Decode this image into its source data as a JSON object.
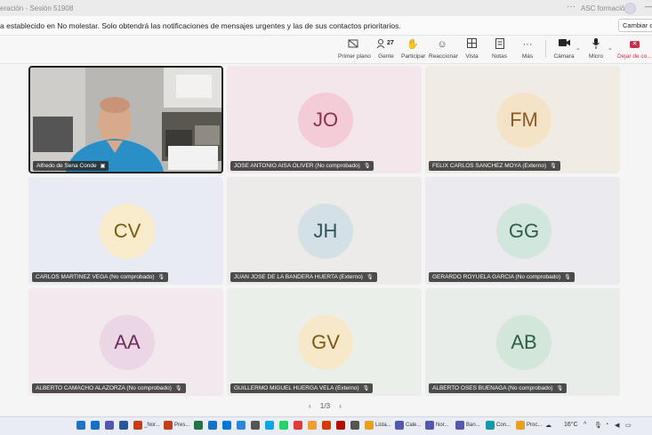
{
  "window": {
    "title_fragment": "eración - Sesión 51908",
    "org_name": "ASC formación",
    "more_label": "···",
    "minimize_label": "—"
  },
  "notice": {
    "message": "a establecido en No molestar. Solo obtendrá las notificaciones de mensajes urgentes y las de sus contactos prioritarios.",
    "button_label": "Cambiar co"
  },
  "toolbar": {
    "items": [
      {
        "label": "Primer plano",
        "icon": "spotlight-icon"
      },
      {
        "label": "Gente",
        "icon": "people-icon",
        "badge": "27"
      },
      {
        "label": "Participar",
        "icon": "raise-hand-icon"
      },
      {
        "label": "Reaccionar",
        "icon": "reaction-icon"
      },
      {
        "label": "Vista",
        "icon": "view-grid-icon"
      },
      {
        "label": "Notas",
        "icon": "notes-icon"
      },
      {
        "label": "Más",
        "icon": "more-icon"
      },
      {
        "label": "Cámara",
        "icon": "camera-icon"
      },
      {
        "label": "Micro",
        "icon": "microphone-icon"
      }
    ],
    "leave_label": "Dejar de co..."
  },
  "participants": [
    {
      "name": "Alfredo de Sena Conde",
      "initials": "",
      "video": true
    },
    {
      "name": "JOSE ANTONIO AISA OLIVER (No comprobado)",
      "initials": "JO",
      "bg": "#f3e7ec",
      "avatar_bg": "#f4ccd8",
      "avatar_fg": "#8a2f4e"
    },
    {
      "name": "FELIX CARLOS SANCHEZ MOYA (Externo)",
      "initials": "FM",
      "bg": "#f1ece3",
      "avatar_bg": "#f5e3c8",
      "avatar_fg": "#8a5a22"
    },
    {
      "name": "CARLOS MARTINEZ VEGA (No comprobado)",
      "initials": "CV",
      "bg": "#e8ebf2",
      "avatar_bg": "#f8eccc",
      "avatar_fg": "#7a5c10"
    },
    {
      "name": "JUAN JOSE DE LA BANDERA HUERTA (Externo)",
      "initials": "JH",
      "bg": "#ecebe9",
      "avatar_bg": "#d3e1e6",
      "avatar_fg": "#2f5560"
    },
    {
      "name": "GERARDO ROYUELA GARCIA (No comprobado)",
      "initials": "GG",
      "bg": "#ebeaee",
      "avatar_bg": "#d1e6dc",
      "avatar_fg": "#2e5e48"
    },
    {
      "name": "ALBERTO CAMACHO ALAZORZA (No comprobado)",
      "initials": "AA",
      "bg": "#f1e9ee",
      "avatar_bg": "#ead6e4",
      "avatar_fg": "#6e2e59"
    },
    {
      "name": "GUILLERMO MIGUEL HUERGA VELA (Externo)",
      "initials": "GV",
      "bg": "#ebefe9",
      "avatar_bg": "#f6e8c8",
      "avatar_fg": "#7a5a14"
    },
    {
      "name": "ALBERTO OSES BUENAGA (No comprobado)",
      "initials": "AB",
      "bg": "#e8ede9",
      "avatar_bg": "#d3e6da",
      "avatar_fg": "#2e5e44"
    }
  ],
  "pagination": {
    "prev": "‹",
    "label": "1/3",
    "next": "›"
  },
  "taskbar": {
    "apps": [
      {
        "label": "",
        "color": "#1e73c8"
      },
      {
        "label": "",
        "color": "#1572c4"
      },
      {
        "label": "",
        "color": "#5558af"
      },
      {
        "label": "",
        "color": "#2b579a"
      },
      {
        "label": "_Nor...",
        "color": "#c43e1c"
      },
      {
        "label": "Pres...",
        "color": "#c43e1c"
      },
      {
        "label": "",
        "color": "#217346"
      },
      {
        "label": "",
        "color": "#1572c4"
      },
      {
        "label": "",
        "color": "#0078d4"
      },
      {
        "label": "",
        "color": "#2b88d8"
      },
      {
        "label": "",
        "color": "#555555"
      },
      {
        "label": "",
        "color": "#0ea5e9"
      },
      {
        "label": "",
        "color": "#25d366"
      },
      {
        "label": "",
        "color": "#e03a3a"
      },
      {
        "label": "",
        "color": "#f0a030"
      },
      {
        "label": "",
        "color": "#d83b01"
      },
      {
        "label": "",
        "color": "#b30b00"
      },
      {
        "label": "",
        "color": "#555555"
      },
      {
        "label": "Lista...",
        "color": "#e8a020"
      },
      {
        "label": "Cale...",
        "color": "#5558af"
      },
      {
        "label": "Nor...",
        "color": "#5558af"
      },
      {
        "label": "Ban...",
        "color": "#5558af"
      },
      {
        "label": "Con...",
        "color": "#0f9ba8"
      },
      {
        "label": "Proc...",
        "color": "#e8a020"
      }
    ],
    "temperature": "16°C"
  }
}
